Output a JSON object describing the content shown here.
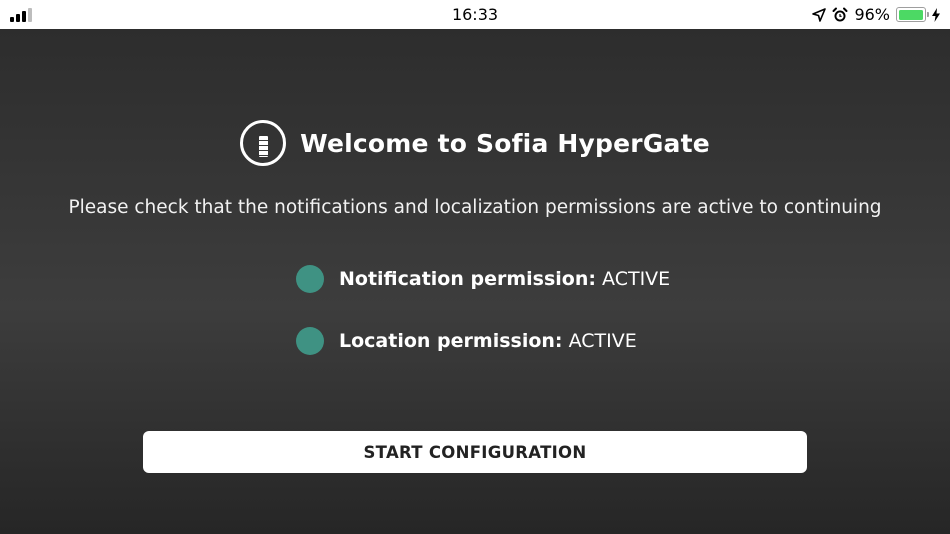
{
  "status_bar": {
    "time": "16:33",
    "battery_percent": "96%",
    "battery_level": 0.96,
    "signal_bars": 4,
    "signal_bars_active": 3,
    "icons": [
      "location-arrow-icon",
      "alarm-clock-icon",
      "battery-icon",
      "charging-bolt-icon"
    ]
  },
  "welcome": {
    "title": "Welcome to Sofia HyperGate",
    "subtitle": "Please check that the notifications and localization permissions are active to continuing"
  },
  "permissions": [
    {
      "label": "Notification permission:",
      "status": "ACTIVE",
      "color": "#3f9283"
    },
    {
      "label": "Location permission:",
      "status": "ACTIVE",
      "color": "#3f9283"
    }
  ],
  "actions": {
    "start_label": "START CONFIGURATION"
  },
  "colors": {
    "active_status": "#3f9283",
    "battery": "#4cd964"
  }
}
